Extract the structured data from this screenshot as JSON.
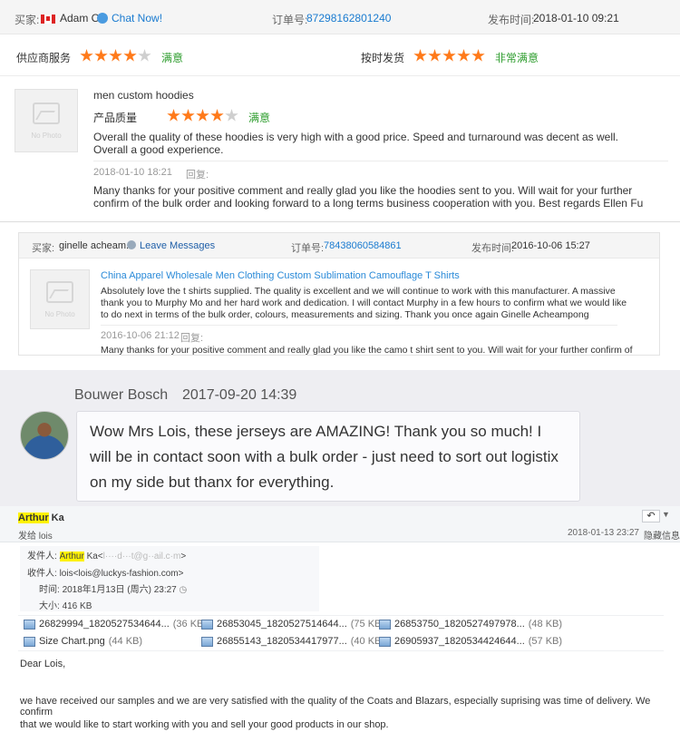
{
  "review1": {
    "buyer_label": "买家:",
    "buyer_name": "Adam C",
    "chat": "Chat Now!",
    "order_label": "订单号:",
    "order_no": "87298162801240",
    "time_label": "发布时间:",
    "time": "2018-01-10 09:21",
    "supplier_label": "供应商服务",
    "supplier_rating": 4,
    "supplier_text": "满意",
    "ship_label": "按时发货",
    "ship_rating": 5,
    "ship_text": "非常满意",
    "nophoto": "No Photo",
    "product": "men custom hoodies",
    "quality_label": "产品质量",
    "quality_rating": 4,
    "quality_text": "满意",
    "comment": "Overall the quality of these hoodies is very high with a good price. Speed and turnaround was decent as well. Overall a good experience.",
    "reply_time": "2018-01-10 18:21",
    "reply_label": "回复:",
    "reply": "Many thanks for your positive comment and really glad you like the hoodies sent to you. Will wait for your further confirm of the bulk order and looking forward to a long terms business cooperation with you. Best regards Ellen Fu"
  },
  "review2": {
    "buyer_label": "买家:",
    "buyer_name": "ginelle acheam...",
    "leave": "Leave Messages",
    "order_label": "订单号:",
    "order_no": "78438060584861",
    "time_label": "发布时间:",
    "time": "2016-10-06 15:27",
    "nophoto": "No Photo",
    "product": "China Apparel Wholesale Men Clothing Custom Sublimation Camouflage T Shirts",
    "comment": "Absolutely love the t shirts supplied. The quality is excellent and we will continue to work with this manufacturer.  A massive thank you to Murphy Mo and her hard work and dedication.  I will contact Murphy in a few hours to confirm what we would like to do next in terms of the bulk order, colours, measurements and sizing.  Thank you once again Ginelle Acheampong",
    "reply_time": "2016-10-06 21:12",
    "reply_label": "回复:",
    "reply": "Many thanks for your positive comment and really glad you like the camo t shirt sent to you. Will wait for your further confirm of"
  },
  "chat": {
    "name": "Bouwer Bosch",
    "time": "2017-09-20 14:39",
    "message": "Wow Mrs Lois, these jerseys are AMAZING!  Thank you so much!  I will be in contact soon with a bulk order - just need to sort out logistix on my side but thanx for everything."
  },
  "email": {
    "sender_first": "Arthur",
    "sender_last": " Ka",
    "to_line": "发给 lois",
    "date": "2018-01-13 23:27",
    "hide_info": "隐藏信息",
    "from_label": "发件人:",
    "from_first": "Arthur",
    "from_rest": " Ka<",
    "from_masked": "l····d···t@g··ail.c·m",
    "from_end": ">",
    "to_label": "收件人:",
    "to_value": "lois<lois@luckys-fashion.com>",
    "time_label": "时间:",
    "time_value": "2018年1月13日 (周六) 23:27",
    "size_label": "大小:",
    "size_value": "416 KB",
    "attachments": [
      {
        "name": "26829994_1820527534644...",
        "size": "(36 KB)"
      },
      {
        "name": "26853045_1820527514644...",
        "size": "(75 KB)"
      },
      {
        "name": "26853750_1820527497978...",
        "size": "(48 KB)"
      },
      {
        "name": "Size Chart.png",
        "size": "(44 KB)"
      },
      {
        "name": "26855143_1820534417977...",
        "size": "(40 KB)"
      },
      {
        "name": "26905937_1820534424644...",
        "size": "(57 KB)"
      }
    ],
    "greeting": "Dear Lois,",
    "body1": "we have received our samples and we are very satisfied with the quality of the Coats and Blazars, especially suprising was time of delivery. We confirm",
    "body2": "that we would like to start working with you and sell your good products in our shop."
  }
}
